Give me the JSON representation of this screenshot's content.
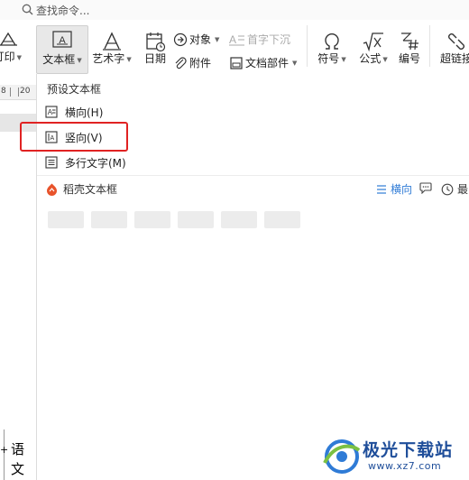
{
  "search": {
    "placeholder": "查找命令..."
  },
  "ribbon": {
    "partial_left": {
      "label": "打印"
    },
    "textbox": {
      "label": "文本框"
    },
    "arttext": {
      "label": "艺术字"
    },
    "date": {
      "label": "日期"
    },
    "object": {
      "label": "对象"
    },
    "dropcap": {
      "label": "首字下沉"
    },
    "attachment": {
      "label": "附件"
    },
    "docpart": {
      "label": "文档部件"
    },
    "symbol": {
      "label": "符号"
    },
    "formula": {
      "label": "公式"
    },
    "numbering": {
      "label": "编号"
    },
    "hyperlink": {
      "label": "超链接"
    }
  },
  "ruler": {
    "left": "8",
    "right": "20"
  },
  "panel": {
    "preset_title": "预设文本框",
    "items": [
      {
        "label": "横向(H)"
      },
      {
        "label": "竖向(V)"
      },
      {
        "label": "多行文字(M)"
      }
    ],
    "daoke_title": "稻壳文本框",
    "filter_label": "横向",
    "recent_label": "最"
  },
  "document": {
    "char1": "语",
    "char2": "文",
    "mark": "+"
  },
  "watermark": {
    "brand": "极光下载站",
    "url": "www.xz7.com"
  },
  "colors": {
    "highlight": "#e02222",
    "accent": "#2f7bd6",
    "brand": "#1f4e9a",
    "daoke": "#e8532b"
  }
}
